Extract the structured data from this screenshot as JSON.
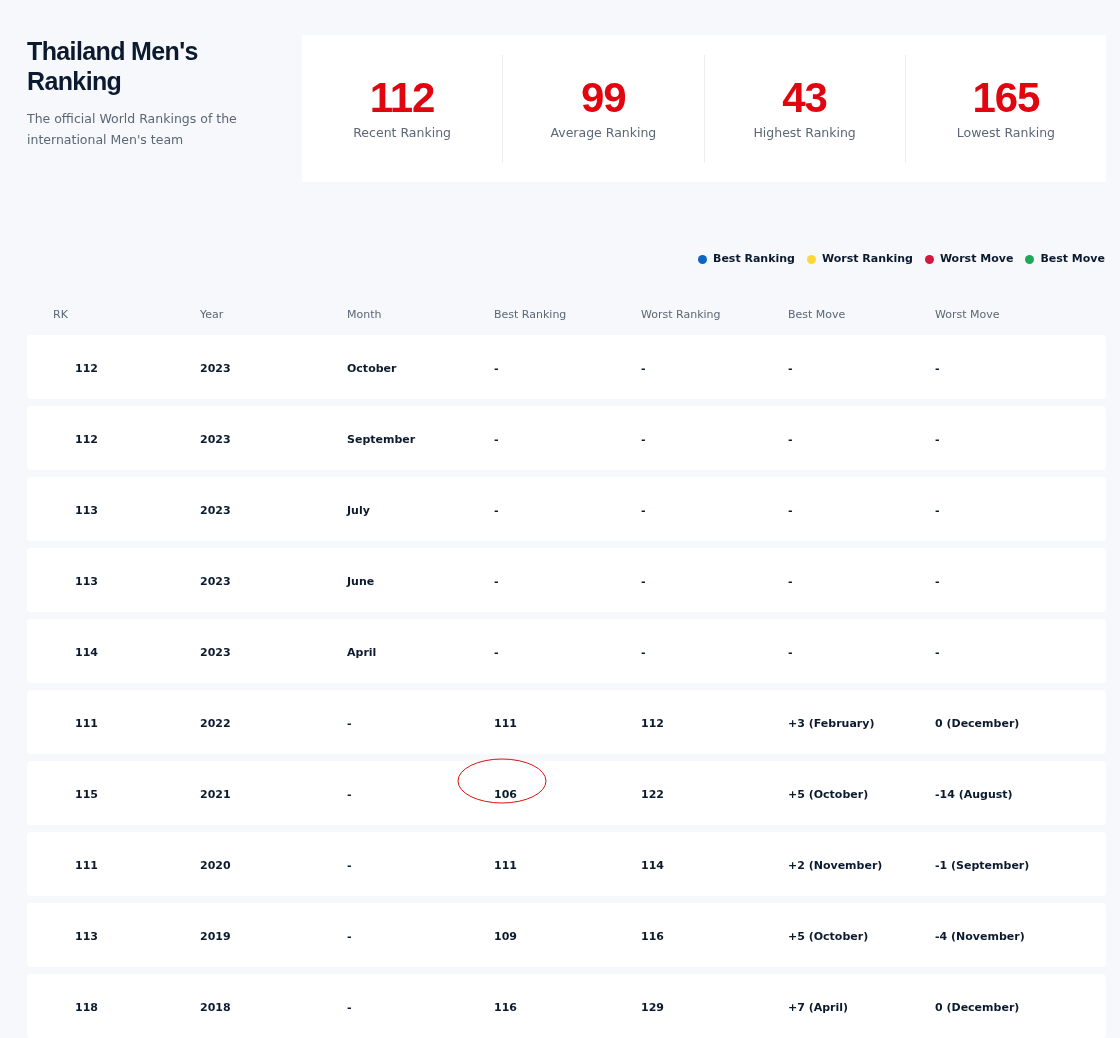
{
  "header": {
    "title": "Thailand Men's Ranking",
    "subtitle": "The official World Rankings of the international Men's team"
  },
  "stats": [
    {
      "value": "112",
      "label": "Recent Ranking"
    },
    {
      "value": "99",
      "label": "Average Ranking"
    },
    {
      "value": "43",
      "label": "Highest Ranking"
    },
    {
      "value": "165",
      "label": "Lowest Ranking"
    }
  ],
  "legend": [
    {
      "label": "Best Ranking",
      "color": "#0b66c3"
    },
    {
      "label": "Worst Ranking",
      "color": "#fdd835"
    },
    {
      "label": "Worst Move",
      "color": "#d3173d"
    },
    {
      "label": "Best Move",
      "color": "#1ea85a"
    }
  ],
  "table": {
    "columns": [
      "RK",
      "Year",
      "Month",
      "Best Ranking",
      "Worst Ranking",
      "Best Move",
      "Worst Move"
    ],
    "rows": [
      {
        "cells": [
          "112",
          "2023",
          "October",
          "-",
          "-",
          "-",
          "-"
        ],
        "circled": false
      },
      {
        "cells": [
          "112",
          "2023",
          "September",
          "-",
          "-",
          "-",
          "-"
        ],
        "circled": false
      },
      {
        "cells": [
          "113",
          "2023",
          "July",
          "-",
          "-",
          "-",
          "-"
        ],
        "circled": false
      },
      {
        "cells": [
          "113",
          "2023",
          "June",
          "-",
          "-",
          "-",
          "-"
        ],
        "circled": false
      },
      {
        "cells": [
          "114",
          "2023",
          "April",
          "-",
          "-",
          "-",
          "-"
        ],
        "circled": false
      },
      {
        "cells": [
          "111",
          "2022",
          "-",
          "111",
          "112",
          "+3 (February)",
          "0 (December)"
        ],
        "circled": false
      },
      {
        "cells": [
          "115",
          "2021",
          "-",
          "106",
          "122",
          "+5 (October)",
          "-14 (August)"
        ],
        "circled": true
      },
      {
        "cells": [
          "111",
          "2020",
          "-",
          "111",
          "114",
          "+2 (November)",
          "-1 (September)"
        ],
        "circled": false
      },
      {
        "cells": [
          "113",
          "2019",
          "-",
          "109",
          "116",
          "+5 (October)",
          "-4 (November)"
        ],
        "circled": false
      },
      {
        "cells": [
          "118",
          "2018",
          "-",
          "116",
          "129",
          "+7 (April)",
          "0 (December)"
        ],
        "circled": false
      }
    ]
  }
}
